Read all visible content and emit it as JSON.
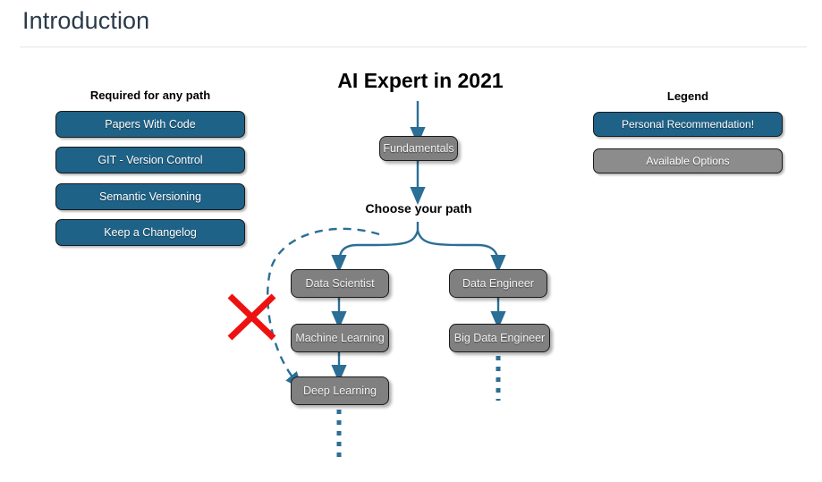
{
  "header": {
    "title": "Introduction"
  },
  "colors": {
    "accent_blue": "#1f6287",
    "node_gray": "#808080",
    "connector_blue": "#2b6e96",
    "cross_red": "#ee1111",
    "title_slate": "#2b3a4a"
  },
  "required_section": {
    "caption": "Required for any path",
    "items": [
      {
        "label": "Papers With Code",
        "style": "blue"
      },
      {
        "label": "GIT - Version Control",
        "style": "blue"
      },
      {
        "label": "Semantic Versioning",
        "style": "blue"
      },
      {
        "label": "Keep a Changelog",
        "style": "blue"
      }
    ]
  },
  "legend_section": {
    "caption": "Legend",
    "items": [
      {
        "label": "Personal Recommendation!",
        "style": "blue"
      },
      {
        "label": "Available Options",
        "style": "gray"
      }
    ]
  },
  "flow": {
    "title": "AI Expert in 2021",
    "choose_label": "Choose your path",
    "root": {
      "label": "Fundamentals"
    },
    "branches": [
      {
        "name": "data-scientist-path",
        "nodes": [
          {
            "label": "Data Scientist"
          },
          {
            "label": "Machine Learning"
          },
          {
            "label": "Deep Learning"
          }
        ]
      },
      {
        "name": "data-engineer-path",
        "nodes": [
          {
            "label": "Data Engineer"
          },
          {
            "label": "Big Data Engineer"
          }
        ]
      }
    ],
    "shortcut": {
      "name": "shortcut-dashed-path",
      "from": "choose-your-path",
      "to": "Deep Learning",
      "marked_invalid": true,
      "marker": "red-cross"
    }
  }
}
